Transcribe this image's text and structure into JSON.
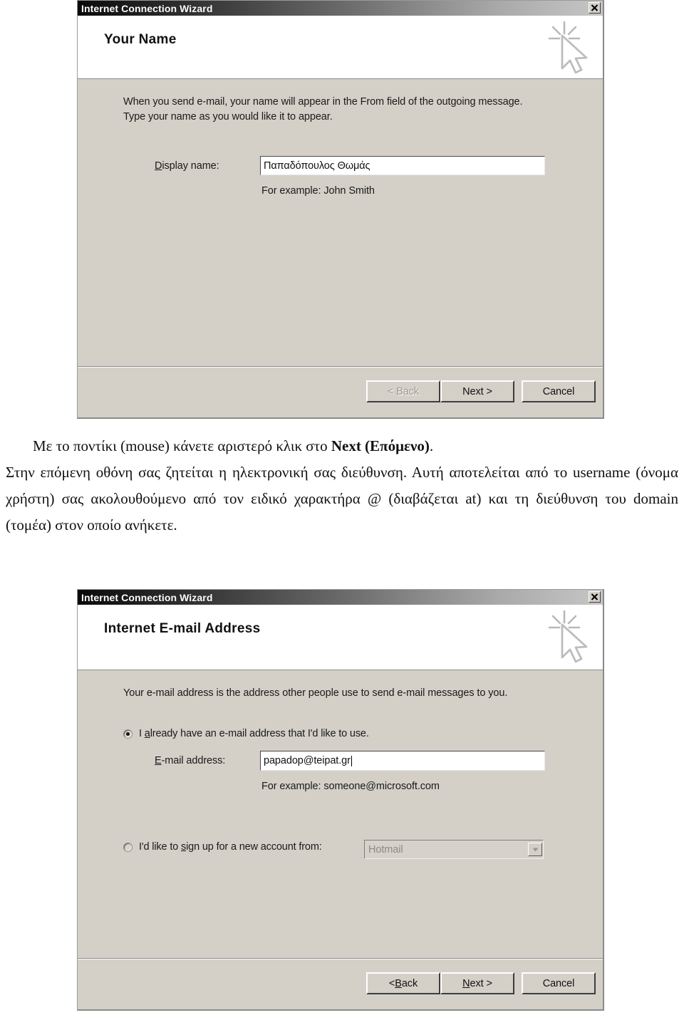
{
  "dialog1": {
    "titlebar": "Internet Connection Wizard",
    "close_icon": "close-x-icon",
    "banner_title": "Your Name",
    "banner_icon": "cursor-sparkle-icon",
    "paragraph_line1": "When you send e-mail, your name will appear in the From field of the outgoing message.",
    "paragraph_line2": "Type your name as you would like it to appear.",
    "display_name_label": "Display name:",
    "display_name_value": "Παπαδόπουλος Θωμάς",
    "example_hint": "For example: John Smith",
    "buttons": {
      "back": "< Back",
      "back_disabled": true,
      "next": "Next >",
      "cancel": "Cancel"
    }
  },
  "prose": {
    "p1_before_bold": "Με το ποντίκι (mouse) κάνετε αριστερό κλικ στο ",
    "p1_bold": "Next (Επόμενο)",
    "p1_after_bold": ".",
    "p2": "Στην επόμενη οθόνη σας ζητείται η ηλεκτρονική σας διεύθυνση. Αυτή αποτελείται από το username (όνομα χρήστη) σας ακολουθούμενο από τον ειδικό χαρακτήρα @ (διαβάζεται at) και τη διεύθυνση του domain (τομέα) στον οποίο ανήκετε."
  },
  "dialog2": {
    "titlebar": "Internet Connection Wizard",
    "close_icon": "close-x-icon",
    "banner_title": "Internet E-mail Address",
    "banner_icon": "cursor-sparkle-icon",
    "paragraph_line1": "Your e-mail address is the address other people use to send e-mail messages to you.",
    "radio_existing_label": "I already have an e-mail address that I'd like to use.",
    "radio_existing_checked": true,
    "email_label": "E-mail address:",
    "email_value": "papadop@teipat.gr",
    "example_hint": "For example: someone@microsoft.com",
    "radio_signup_label": "I'd like to sign up for a new account from:",
    "radio_signup_checked": false,
    "signup_provider_value": "Hotmail",
    "signup_provider_disabled": true,
    "dropdown_icon": "chevron-down-icon",
    "buttons": {
      "back": "< Back",
      "back_disabled": false,
      "next": "Next >",
      "cancel": "Cancel"
    }
  },
  "colors": {
    "dialog_face": "#d4d0c8",
    "titlebar_dark": "#0a0a0a",
    "titlebar_light": "#c6c6c6",
    "field_background": "#ffffff",
    "text": "#111111",
    "disabled_text": "#9c9890"
  }
}
